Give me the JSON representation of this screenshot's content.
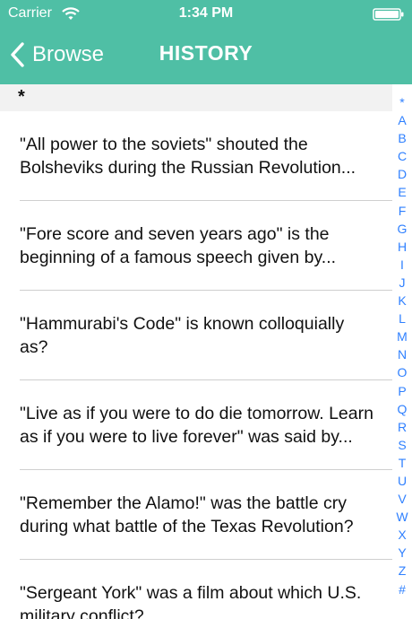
{
  "status_bar": {
    "carrier": "Carrier",
    "time": "1:34 PM"
  },
  "nav": {
    "back_label": "Browse",
    "title": "HISTORY"
  },
  "section": {
    "header": "*"
  },
  "rows": [
    "\"All power to the soviets\" shouted the Bolsheviks during the Russian Revolution...",
    "\"Fore score and seven years ago\" is the beginning of a famous speech given by...",
    "\"Hammurabi's Code\" is known colloquially as?",
    "\"Live as if you were to do die tomorrow. Learn as if you were to live forever\" was said by...",
    "\"Remember the Alamo!\" was the battle cry during what battle of the Texas Revolution?",
    "\"Sergeant York\" was a film about which U.S. military conflict?"
  ],
  "index": [
    "*",
    "A",
    "B",
    "C",
    "D",
    "E",
    "F",
    "G",
    "H",
    "I",
    "J",
    "K",
    "L",
    "M",
    "N",
    "O",
    "P",
    "Q",
    "R",
    "S",
    "T",
    "U",
    "V",
    "W",
    "X",
    "Y",
    "Z",
    "#"
  ],
  "colors": {
    "header": "#4fbfa5",
    "index": "#2f80ff",
    "section": "#f2f2f2"
  }
}
